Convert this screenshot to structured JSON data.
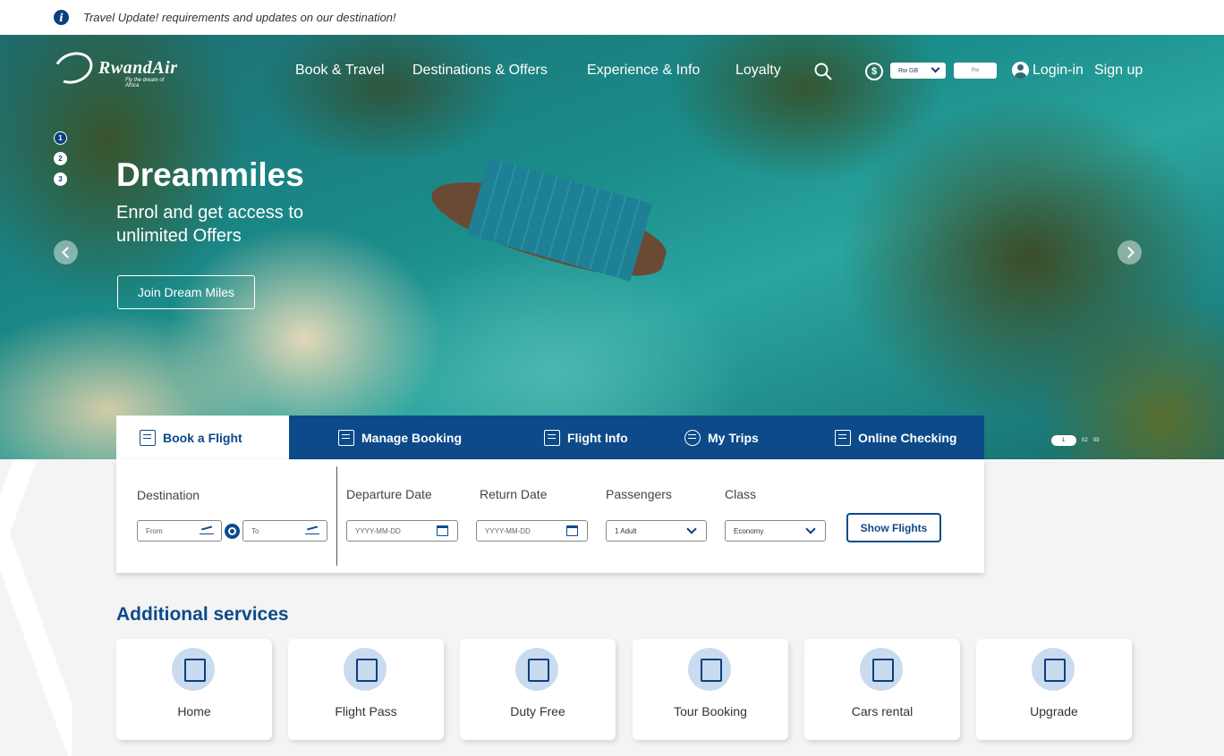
{
  "notice": {
    "text": "Travel Update! requirements and updates on our destination!"
  },
  "brand": {
    "name": "RwandAir",
    "tagline": "Fly the dream of Africa"
  },
  "nav": {
    "items": [
      "Book & Travel",
      "Destinations  & Offers",
      "Experience &  Info",
      "Loyalty"
    ],
    "language": "Rw  GB",
    "rw_box": "Rw",
    "login": "Login-in",
    "signup": "Sign up"
  },
  "slider": {
    "dots": [
      "1",
      "2",
      "3"
    ],
    "active_dot": 1,
    "title": "Dreammiles",
    "subtitle": "Enrol and get access to unlimited Offers",
    "cta": "Join Dream Miles",
    "pager": [
      "1.",
      "02",
      "03"
    ]
  },
  "tabs": [
    {
      "label": "Book a Flight",
      "icon": "ticket-icon",
      "active": true
    },
    {
      "label": "Manage Booking",
      "icon": "calendar-check-icon",
      "active": false
    },
    {
      "label": "Flight Info",
      "icon": "document-icon",
      "active": false
    },
    {
      "label": "My Trips",
      "icon": "globe-plane-icon",
      "active": false
    },
    {
      "label": "Online Checking",
      "icon": "checkin-desk-icon",
      "active": false
    }
  ],
  "booking": {
    "destination_label": "Destination",
    "from_placeholder": "From",
    "to_placeholder": "To",
    "departure_label": "Departure Date",
    "departure_placeholder": "YYYY-MM-DD",
    "return_label": "Return Date",
    "return_placeholder": "YYYY-MM-DD",
    "passengers_label": "Passengers",
    "passengers_value": "1 Adult",
    "class_label": "Class",
    "class_value": "Economy",
    "submit": "Show Flights"
  },
  "services": {
    "title": "Additional services",
    "items": [
      {
        "label": "Home",
        "icon": "hotel-icon"
      },
      {
        "label": "Flight Pass",
        "icon": "pass-icon"
      },
      {
        "label": "Duty Free",
        "icon": "shopping-bag-icon"
      },
      {
        "label": "Tour Booking",
        "icon": "phone-tour-icon"
      },
      {
        "label": "Cars rental",
        "icon": "car-icon"
      },
      {
        "label": "Upgrade",
        "icon": "upgrade-icon"
      }
    ]
  },
  "colors": {
    "primary": "#0c4a8a",
    "icon_bg": "#c9dbef"
  }
}
